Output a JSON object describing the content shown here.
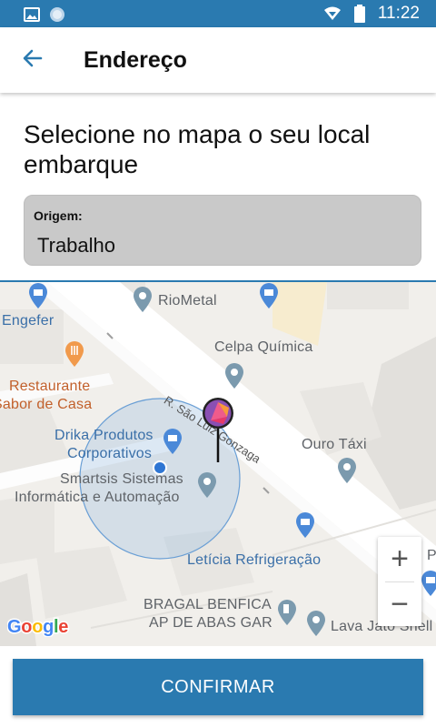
{
  "status_bar": {
    "time": "11:22"
  },
  "app_bar": {
    "title": "Endereço"
  },
  "prompt": {
    "text": "Selecione no mapa o seu local embarque"
  },
  "origin": {
    "label": "Origem:",
    "value": "Trabalho"
  },
  "map": {
    "places": {
      "engefer": "Engefer",
      "riometal": "RioMetal",
      "celpa": "Celpa Química",
      "restaurante_line1": "Restaurante",
      "restaurante_line2": "Sabor de Casa",
      "drika_line1": "Drika Produtos",
      "drika_line2": "Corporativos",
      "smartsis_line1": "Smartsis Sistemas",
      "smartsis_line2": "Informática e Automação",
      "ouro_taxi": "Ouro Táxi",
      "leticia": "Letícia Refrigeração",
      "bragal_line1": "BRAGAL BENFICA",
      "bragal_line2": "AP DE ABAS GAR",
      "lava_jato": "Lava Jato Shell",
      "posto": "Posto"
    },
    "road": "R. São Luiz Gonzaga",
    "zoom_in": "+",
    "zoom_out": "−",
    "attribution": "Google"
  },
  "confirm_button": "CONFIRMAR",
  "colors": {
    "primary": "#2a7ab0",
    "origin_box": "#c9c9c9",
    "map_bg": "#f1efeb"
  }
}
